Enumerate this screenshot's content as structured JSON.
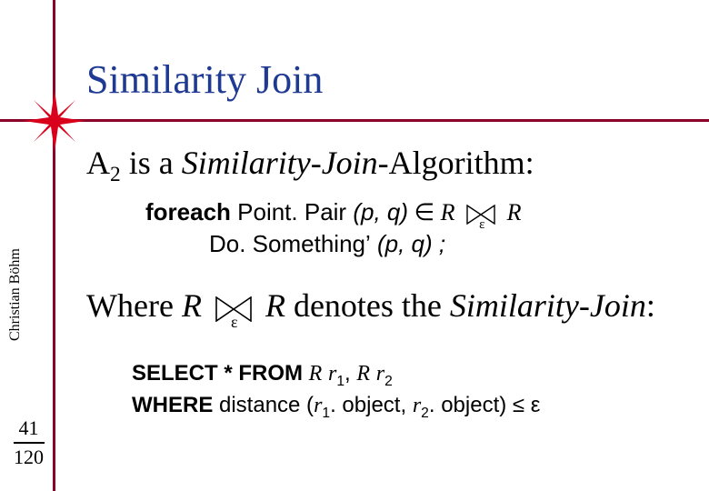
{
  "title": "Similarity Join",
  "a2": {
    "prefix": "A",
    "sub": "2",
    "rest": " is a ",
    "ital": "Similarity-Join",
    "tail": "-Algorithm:"
  },
  "code": {
    "foreach": "foreach",
    "pointpair": " Point. Pair ",
    "pq": "(p, q)",
    "in": " ∈ ",
    "R1": "R",
    "R2": "R",
    "do": "Do. Something",
    "prime": "’",
    "pq2": " (p, q) ;",
    "eps": "ε"
  },
  "where": {
    "w": "Where ",
    "R1": "R",
    "R2": "R",
    "rest": "  denotes the ",
    "ital": "Similarity-Join",
    "colon": ":",
    "eps": "ε"
  },
  "sql": {
    "select": "SELECT * FROM ",
    "R": "R",
    "r": "r",
    "one": "1",
    "two": "2",
    "comma": ", ",
    "where": "WHERE ",
    "distance": "distance (",
    "obj": ". object",
    "close": ")",
    "le": " ≤ ",
    "eps": "ε"
  },
  "author": "Christian Böhm",
  "page": {
    "cur": "41",
    "total": "120"
  }
}
